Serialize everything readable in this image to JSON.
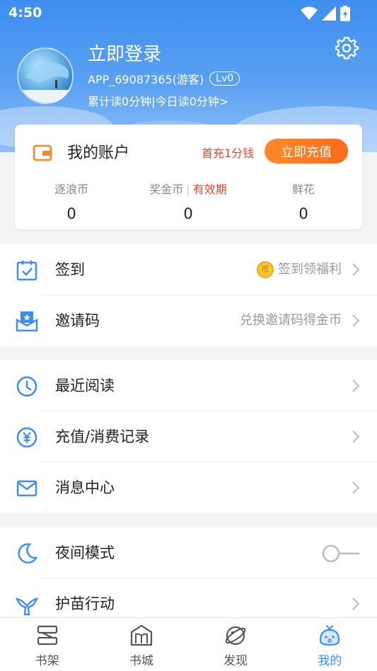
{
  "status": {
    "time": "4:50"
  },
  "profile": {
    "login_title": "立即登录",
    "user_id": "APP_69087365(游客)",
    "level": "Lv0",
    "read_stats": "累计读0分钟|今日读0分钟>"
  },
  "account": {
    "title": "我的账户",
    "promo": "首充1分钱",
    "recharge_label": "立即充值",
    "stats": {
      "waves_label": "逐浪币",
      "waves_value": "0",
      "bonus_label": "奖金币",
      "bonus_sep": "|",
      "bonus_expiry": "有效期",
      "bonus_value": "0",
      "flowers_label": "鲜花",
      "flowers_value": "0"
    }
  },
  "menu": {
    "checkin": {
      "label": "签到",
      "hint": "签到领福利",
      "coin": "币"
    },
    "invite": {
      "label": "邀请码",
      "hint": "兑换邀请码得金币"
    },
    "recent": {
      "label": "最近阅读"
    },
    "records": {
      "label": "充值/消费记录"
    },
    "messages": {
      "label": "消息中心"
    },
    "night": {
      "label": "夜间模式",
      "enabled": false
    },
    "seedling": {
      "label": "护苗行动"
    }
  },
  "tabs": [
    {
      "label": "书架",
      "icon": "bookshelf-icon",
      "active": false
    },
    {
      "label": "书城",
      "icon": "bookstore-icon",
      "active": false
    },
    {
      "label": "发现",
      "icon": "discover-planet-icon",
      "active": false
    },
    {
      "label": "我的",
      "icon": "profile-mascot-icon",
      "active": true
    }
  ],
  "colors": {
    "header_blue": "#3d8ef0",
    "accent_orange": "#ff7a22",
    "alert_red": "#f0432d",
    "icon_blue": "#3d8ef0"
  }
}
